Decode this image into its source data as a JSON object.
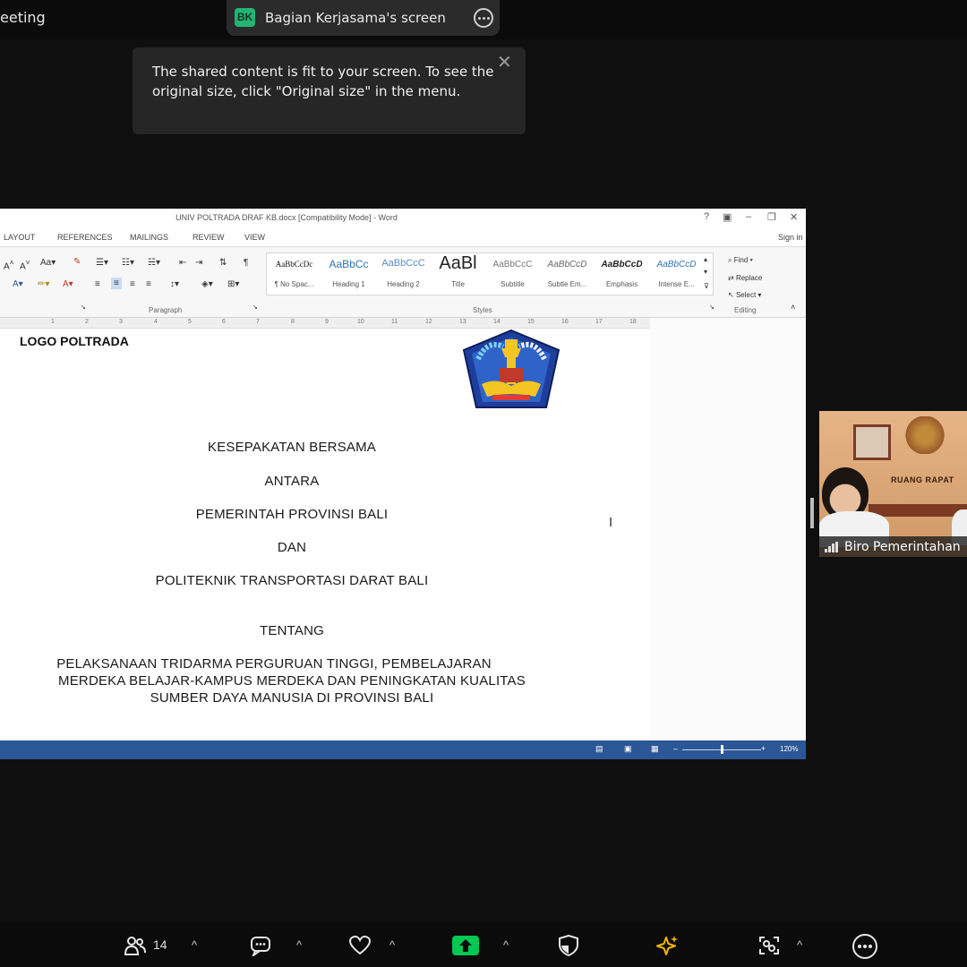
{
  "top": {
    "meeting_title": "eeting",
    "screen_badge": "BK",
    "screen_label": "Bagian Kerjasama's screen",
    "toast": "The shared content is fit to your screen. To see the original size, click \"Original size\" in the menu."
  },
  "word": {
    "title": "UNIV POLTRADA DRAF KB.docx [Compatibility Mode] - Word",
    "sign_in": "Sign in",
    "tabs": [
      "LAYOUT",
      "REFERENCES",
      "MAILINGS",
      "REVIEW",
      "VIEW"
    ],
    "styles": [
      {
        "sample": "AaBbCcDc",
        "name": "¶ No Spac..."
      },
      {
        "sample": "AaBbCc",
        "name": "Heading 1"
      },
      {
        "sample": "AaBbCcC",
        "name": "Heading 2"
      },
      {
        "sample": "AaBl",
        "name": "Title"
      },
      {
        "sample": "AaBbCcC",
        "name": "Subtitle"
      },
      {
        "sample": "AaBbCcD",
        "name": "Subtle Em..."
      },
      {
        "sample": "AaBbCcD",
        "name": "Emphasis"
      },
      {
        "sample": "AaBbCcD",
        "name": "Intense E..."
      }
    ],
    "groups": {
      "paragraph": "Paragraph",
      "styles": "Styles",
      "editing": "Editing"
    },
    "editing": {
      "find": "Find",
      "replace": "Replace",
      "select": "Select"
    },
    "ruler": [
      "1",
      "2",
      "3",
      "4",
      "5",
      "6",
      "7",
      "8",
      "9",
      "10",
      "11",
      "12",
      "13",
      "14",
      "15",
      "16",
      "17",
      "18"
    ],
    "document": {
      "logo_label": "LOGO POLTRADA",
      "lines": [
        "KESEPAKATAN BERSAMA",
        "ANTARA",
        "PEMERINTAH PROVINSI BALI",
        "DAN",
        "POLITEKNIK TRANSPORTASI DARAT BALI",
        "TENTANG",
        "PELAKSANAAN TRIDARMA PERGURUAN TINGGI, PEMBELAJARAN",
        "MERDEKA BELAJAR-KAMPUS MERDEKA DAN PENINGKATAN KUALITAS",
        "SUMBER DAYA MANUSIA DI PROVINSI BALI"
      ]
    },
    "status": {
      "zoom": "120%"
    }
  },
  "participant": {
    "name": "Biro Pemerintahan",
    "room_label": "RUANG RAPAT"
  },
  "toolbar": {
    "participants_count": "14"
  },
  "colors": {
    "background": "#0f0f0f",
    "badge": "#22b573",
    "share_button": "#00c853",
    "word_status": "#2b5797",
    "ai_icon": "#f4b400"
  }
}
